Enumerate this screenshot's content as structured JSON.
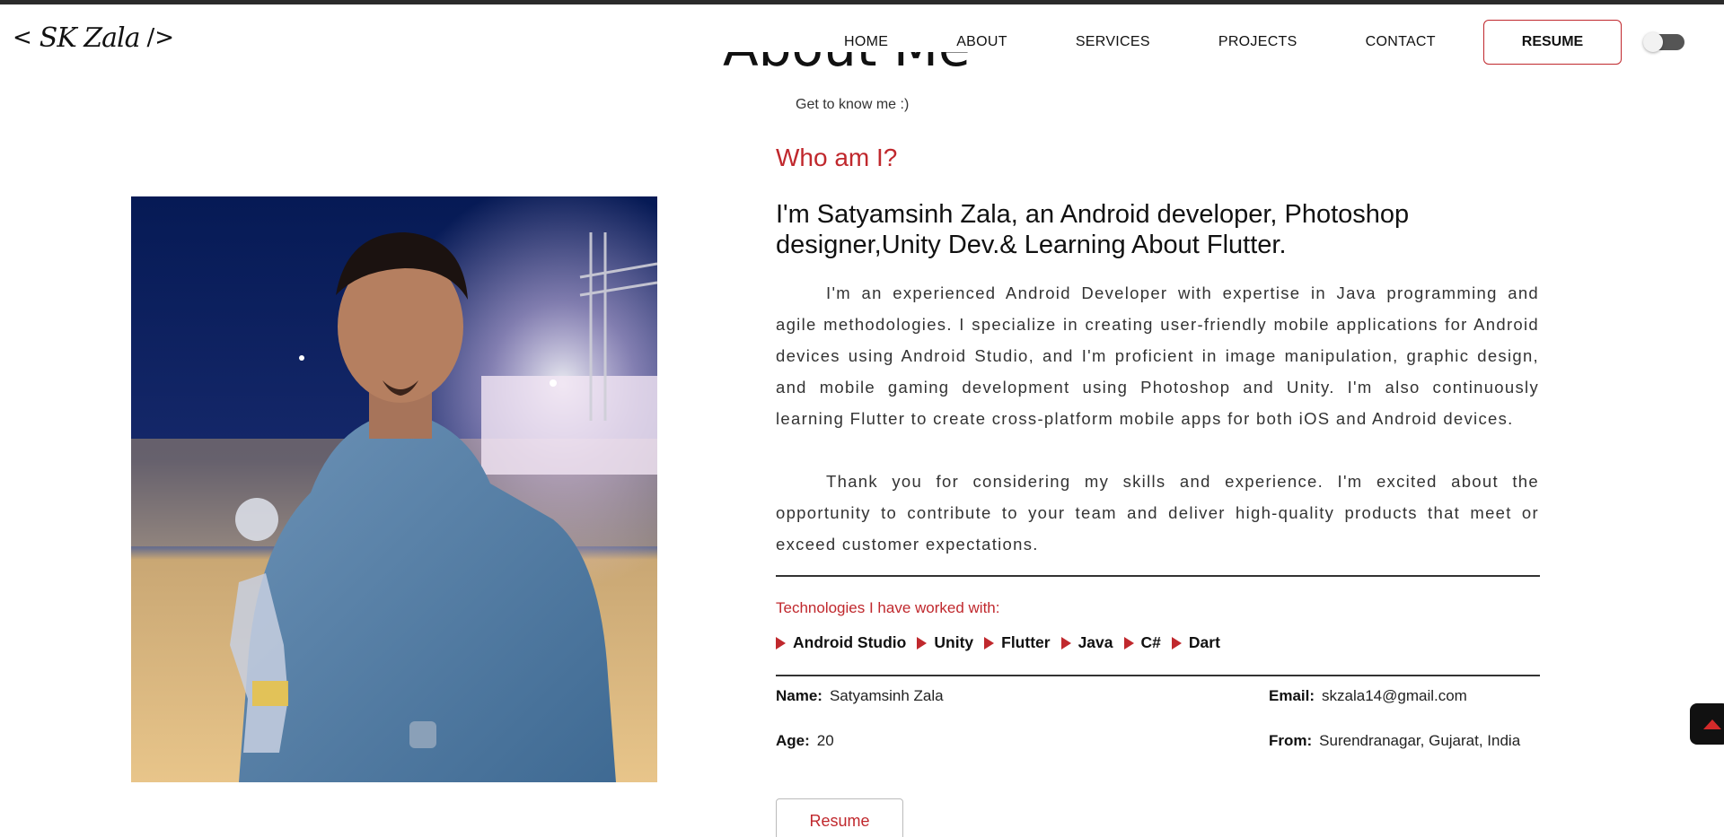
{
  "logo": {
    "open": "<",
    "signature": "SK Zala",
    "close": "/>"
  },
  "nav": {
    "items": [
      "HOME",
      "ABOUT",
      "SERVICES",
      "PROJECTS",
      "CONTACT"
    ],
    "resume_label": "RESUME"
  },
  "theme_toggle": {
    "state": "off"
  },
  "section": {
    "title": "About Me",
    "subtitle": "Get to know me :)"
  },
  "about": {
    "who_heading": "Who am I?",
    "headline": "I'm Satyamsinh Zala, an Android developer, Photoshop designer,Unity Dev.& Learning About Flutter.",
    "paragraph1": "I'm an experienced Android Developer with expertise in Java programming and agile methodologies. I specialize in creating user-friendly mobile applications for Android devices using Android Studio, and I'm proficient in image manipulation, graphic design, and mobile gaming development using Photoshop and Unity. I'm also continuously learning Flutter to create cross-platform mobile apps for both iOS and Android devices.",
    "paragraph2": "Thank you for considering my skills and experience. I'm excited about the opportunity to contribute to your team and deliver high-quality products that meet or exceed customer expectations.",
    "tech_label": "Technologies I have worked with:",
    "technologies": [
      "Android Studio",
      "Unity",
      "Flutter",
      "Java",
      "C#",
      "Dart"
    ],
    "info": {
      "name_label": "Name:",
      "name_value": "Satyamsinh Zala",
      "email_label": "Email:",
      "email_value": "skzala14@gmail.com",
      "age_label": "Age:",
      "age_value": "20",
      "from_label": "From:",
      "from_value": "Surendranagar, Gujarat, India"
    },
    "resume_button": "Resume"
  },
  "colors": {
    "accent": "#c0282d",
    "text": "#111111",
    "muted": "#333333"
  },
  "icons": {
    "scroll_top": "caret-up-icon",
    "bullet": "play-triangle-icon"
  }
}
